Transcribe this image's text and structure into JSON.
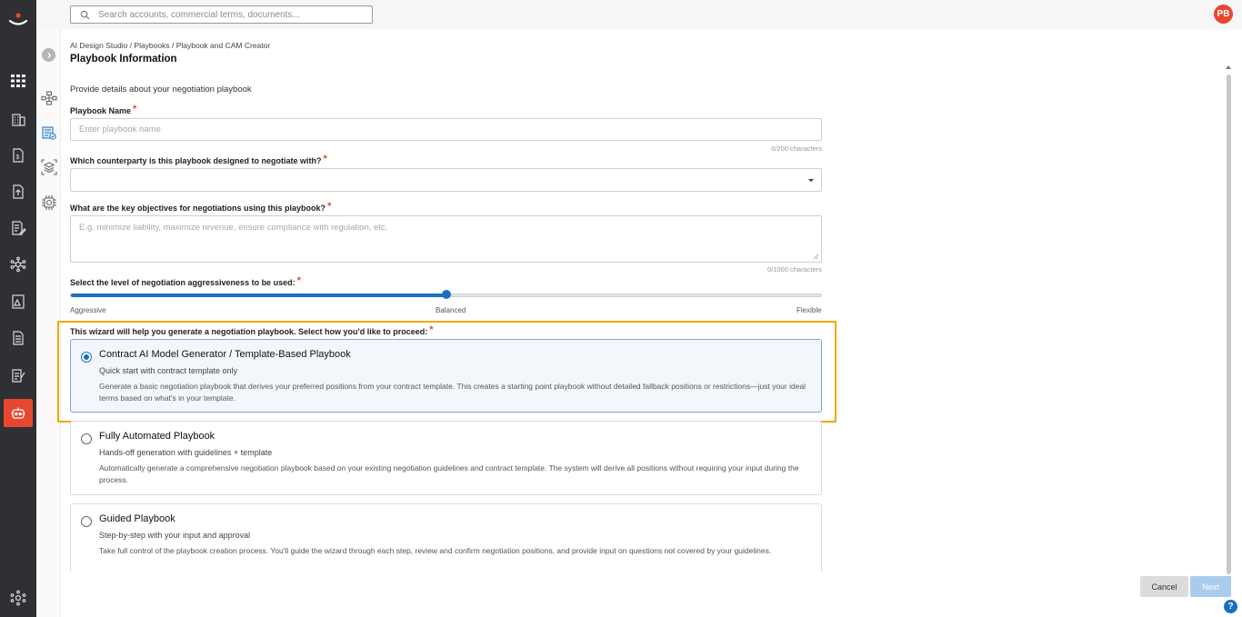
{
  "app": {
    "avatar_initials": "PB",
    "accent_color": "#e8472f",
    "primary_color": "#1a6fc4",
    "highlight_color": "#f0a800"
  },
  "search": {
    "placeholder": "Search accounts, commercial terms, documents...",
    "icon": "search-icon"
  },
  "rail": {
    "icons": [
      "logo-icon",
      "grid-icon",
      "building-icon",
      "dollar-document-icon",
      "upload-document-icon",
      "edit-document-icon",
      "network-icon",
      "image-document-icon",
      "list-document-icon",
      "checklist-icon",
      "robot-icon",
      "settings-network-icon"
    ],
    "active_icon": "robot-icon"
  },
  "subrail": {
    "icons": [
      "chevron-right-icon",
      "workflow-icon",
      "document-check-icon",
      "layers-scan-icon",
      "chip-icon"
    ]
  },
  "breadcrumb": "AI Design Studio / Playbooks / Playbook and CAM Creator",
  "page_title": "Playbook Information",
  "intro": "Provide details about your negotiation playbook",
  "form": {
    "name_label": "Playbook Name",
    "name_placeholder": "Enter playbook name",
    "name_counter": "0/200 characters",
    "counterparty_label": "Which counterparty is this playbook designed to negotiate with?",
    "counterparty_value": "",
    "objectives_label": "What are the key objectives for negotiations using this playbook?",
    "objectives_placeholder": "E.g. minimize liability, maximize revenue, ensure compliance with regulation, etc.",
    "objectives_counter": "0/1000 characters",
    "aggressiveness_label": "Select the level of negotiation aggressiveness to be used:",
    "aggressiveness_value": 0.5,
    "aggressiveness_levels": [
      "Aggressive",
      "Balanced",
      "Flexible"
    ],
    "required_mark": "*"
  },
  "wizard": {
    "label": "This wizard will help you generate a negotiation playbook. Select how you'd like to proceed:",
    "options": [
      {
        "title": "Contract AI Model Generator / Template-Based Playbook",
        "subtitle": "Quick start with contract template only",
        "description": "Generate a basic negotiation playbook that derives your preferred positions from your contract template. This creates a starting point playbook without detailed fallback positions or restrictions—just your ideal terms based on what's in your template.",
        "selected": true
      },
      {
        "title": "Fully Automated Playbook",
        "subtitle": "Hands-off generation with guidelines + template",
        "description": "Automatically generate a comprehensive negotiation playbook based on your existing negotiation guidelines and contract template. The system will derive all positions without requiring your input during the process.",
        "selected": false
      },
      {
        "title": "Guided Playbook",
        "subtitle": "Step-by-step with your input and approval",
        "description": "Take full control of the playbook creation process. You'll guide the wizard through each step, review and confirm negotiation positions, and provide input on questions not covered by your guidelines.",
        "selected": false
      }
    ]
  },
  "footer": {
    "cancel_label": "Cancel",
    "next_label": "Next",
    "help_label": "?"
  }
}
